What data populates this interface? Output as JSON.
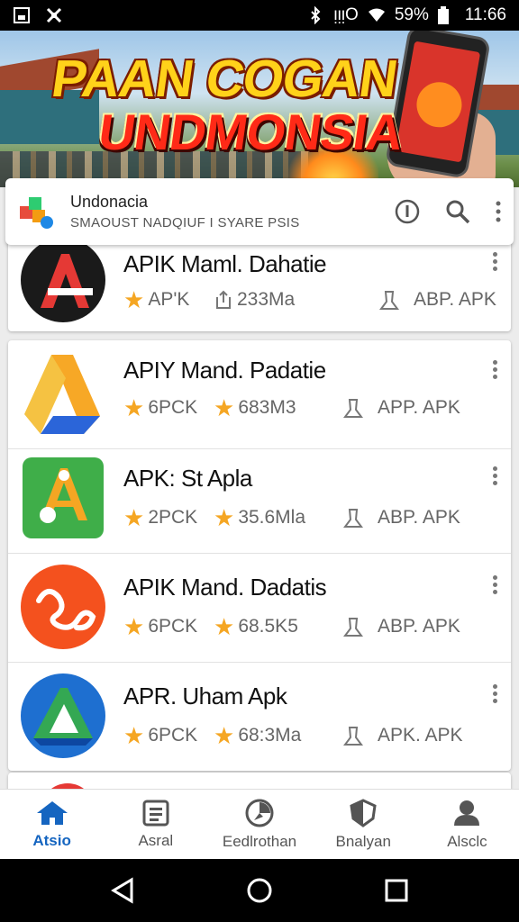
{
  "status_bar": {
    "signal_text": "ᴉᴉᴉO",
    "battery_text": "59%",
    "time": "11:66",
    "icons": [
      "gallery-icon",
      "app-notification-icon",
      "bluetooth-icon",
      "wifi-icon",
      "battery-icon"
    ]
  },
  "banner": {
    "line1": "PAAN COGAN",
    "line2": "UNDMONSIA"
  },
  "app_header": {
    "name": "Undonacia",
    "subtitle": "SMAOUST NADQIUF I SYARE PSIS",
    "icons": [
      "info-icon",
      "search-icon",
      "more-vert-icon"
    ]
  },
  "apps": [
    {
      "title": "APIK Maml. Dahatie",
      "meta1": "AP'K",
      "meta2": "233Ma",
      "meta3": "ABP. APK",
      "meta2_icon": "share-icon"
    },
    {
      "title": "APIY Mand. Padatie",
      "meta1": "6PCK",
      "meta2": "683M3",
      "meta3": "APP. APK",
      "meta2_icon": "star-icon"
    },
    {
      "title": "APK: St Apla",
      "meta1": "2PCK",
      "meta2": "35.6Mla",
      "meta3": "ABP. APK",
      "meta2_icon": "star-icon"
    },
    {
      "title": "APIK Mand. Dadatis",
      "meta1": "6PCK",
      "meta2": "68.5K5",
      "meta3": "ABP. APK",
      "meta2_icon": "star-icon"
    },
    {
      "title": "APR. Uham Apk",
      "meta1": "6PCK",
      "meta2": "68:3Ma",
      "meta3": "APK. APK",
      "meta2_icon": "star-icon"
    }
  ],
  "bottom_nav": [
    {
      "label": "Atsio",
      "icon": "home-icon",
      "active": true
    },
    {
      "label": "Asral",
      "icon": "list-icon",
      "active": false
    },
    {
      "label": "Eedlrothan",
      "icon": "gauge-icon",
      "active": false
    },
    {
      "label": "Bnalyan",
      "icon": "shield-icon",
      "active": false
    },
    {
      "label": "Alsclc",
      "icon": "person-icon",
      "active": false
    }
  ],
  "colors": {
    "accent": "#1565c0",
    "star": "#f5a623",
    "banner_yellow": "#ffd21a",
    "banner_red": "#ff2a17"
  }
}
